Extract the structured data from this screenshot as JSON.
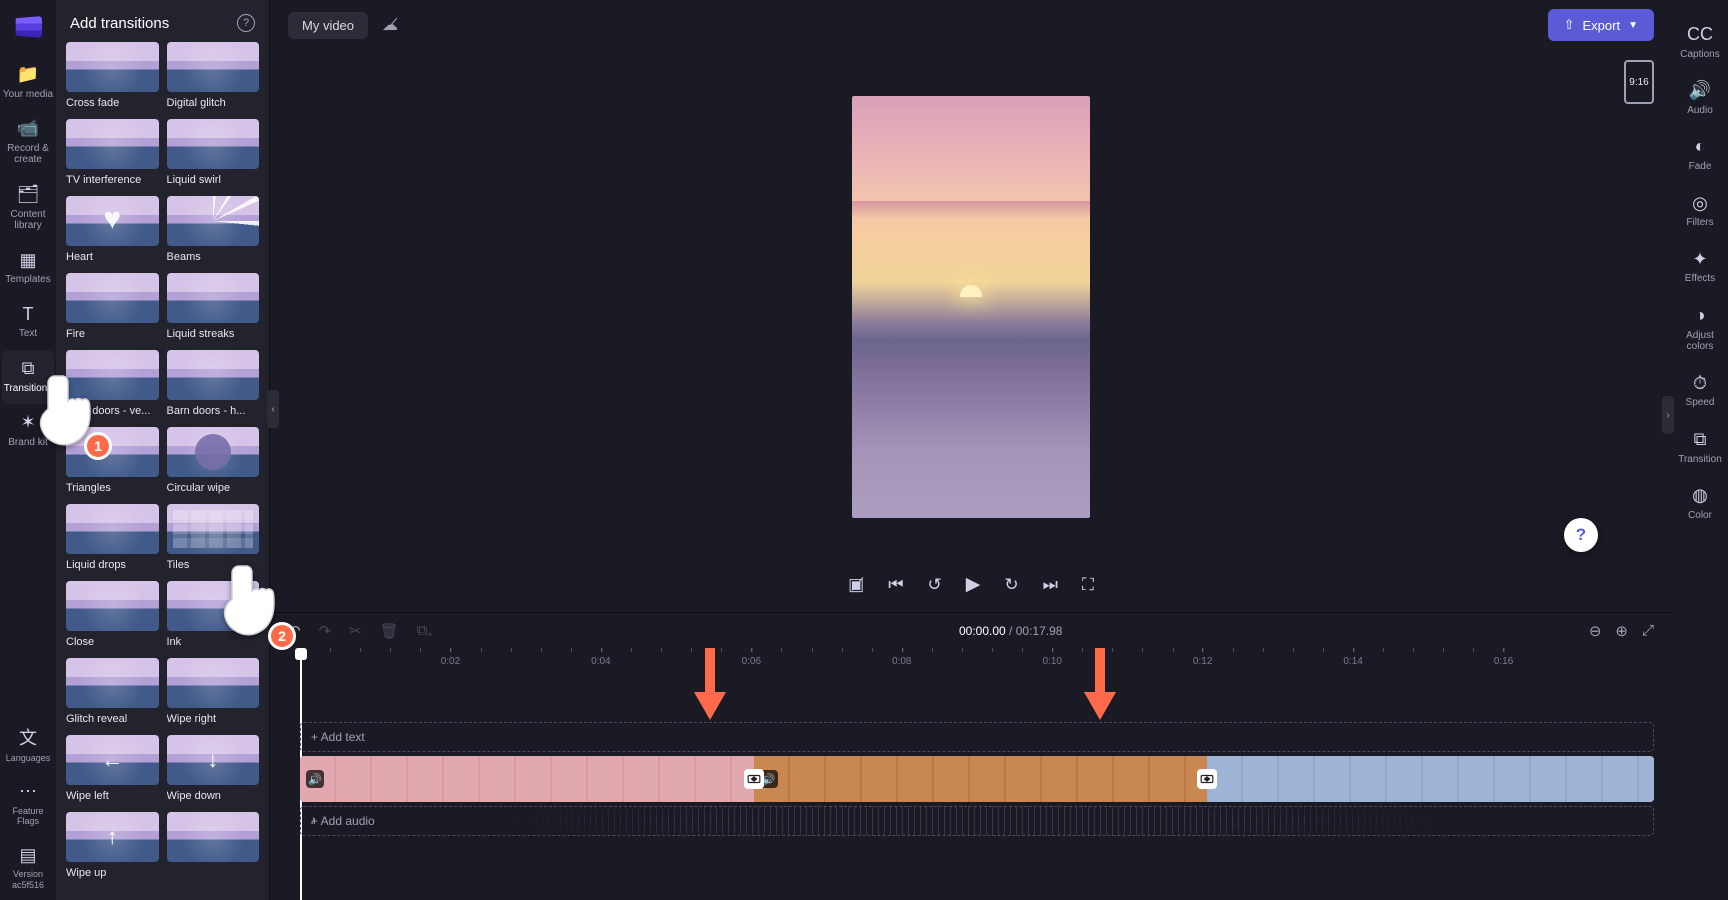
{
  "header": {
    "project_title": "My video",
    "export_label": "Export",
    "aspect_badge": "9:16"
  },
  "left_rail": {
    "items": [
      {
        "icon": "📁",
        "label": "Your media"
      },
      {
        "icon": "📹",
        "label": "Record & create"
      },
      {
        "icon": "🗂",
        "label": "Content library"
      },
      {
        "icon": "▦",
        "label": "Templates"
      },
      {
        "icon": "T",
        "label": "Text"
      },
      {
        "icon": "⧉",
        "label": "Transitions",
        "active": true
      },
      {
        "icon": "✶",
        "label": "Brand kit"
      }
    ],
    "bottom": [
      {
        "icon": "文",
        "label": "Languages"
      },
      {
        "icon": "⋯",
        "label": "Feature Flags"
      },
      {
        "icon": "▤",
        "label": "Version ac5f516"
      }
    ]
  },
  "right_rail": {
    "items": [
      {
        "icon": "CC",
        "label": "Captions"
      },
      {
        "icon": "🔊",
        "label": "Audio"
      },
      {
        "icon": "◐",
        "label": "Fade"
      },
      {
        "icon": "◎",
        "label": "Filters"
      },
      {
        "icon": "✦",
        "label": "Effects"
      },
      {
        "icon": "◑",
        "label": "Adjust colors"
      },
      {
        "icon": "⏱",
        "label": "Speed"
      },
      {
        "icon": "⧉",
        "label": "Transition"
      },
      {
        "icon": "◍",
        "label": "Color"
      }
    ]
  },
  "panel": {
    "title": "Add transitions",
    "transitions": [
      {
        "label": "Cross fade",
        "kind": ""
      },
      {
        "label": "Digital glitch",
        "kind": ""
      },
      {
        "label": "TV interference",
        "kind": ""
      },
      {
        "label": "Liquid swirl",
        "kind": ""
      },
      {
        "label": "Heart",
        "kind": "heart"
      },
      {
        "label": "Beams",
        "kind": "beams"
      },
      {
        "label": "Fire",
        "kind": ""
      },
      {
        "label": "Liquid streaks",
        "kind": ""
      },
      {
        "label": "Barn doors - ve...",
        "kind": ""
      },
      {
        "label": "Barn doors - h...",
        "kind": ""
      },
      {
        "label": "Triangles",
        "kind": ""
      },
      {
        "label": "Circular wipe",
        "kind": "circle"
      },
      {
        "label": "Liquid drops",
        "kind": ""
      },
      {
        "label": "Tiles",
        "kind": "tiles"
      },
      {
        "label": "Close",
        "kind": ""
      },
      {
        "label": "Ink",
        "kind": ""
      },
      {
        "label": "Glitch reveal",
        "kind": ""
      },
      {
        "label": "Wipe right",
        "kind": ""
      },
      {
        "label": "Wipe left",
        "kind": "arrow-left"
      },
      {
        "label": "Wipe down",
        "kind": "arrow-down"
      },
      {
        "label": "Wipe up",
        "kind": "arrow-up"
      },
      {
        "label": "",
        "kind": ""
      }
    ]
  },
  "timecode": {
    "current": "00:00.00",
    "total": "00:17.98"
  },
  "timeline": {
    "ticks": [
      "0:02",
      "0:04",
      "0:06",
      "0:08",
      "0:10",
      "0:12",
      "0:14",
      "0:16"
    ],
    "text_placeholder": "+ Add text",
    "audio_placeholder": "+ Add audio"
  },
  "tutorial": {
    "step1": "1",
    "step2": "2"
  }
}
